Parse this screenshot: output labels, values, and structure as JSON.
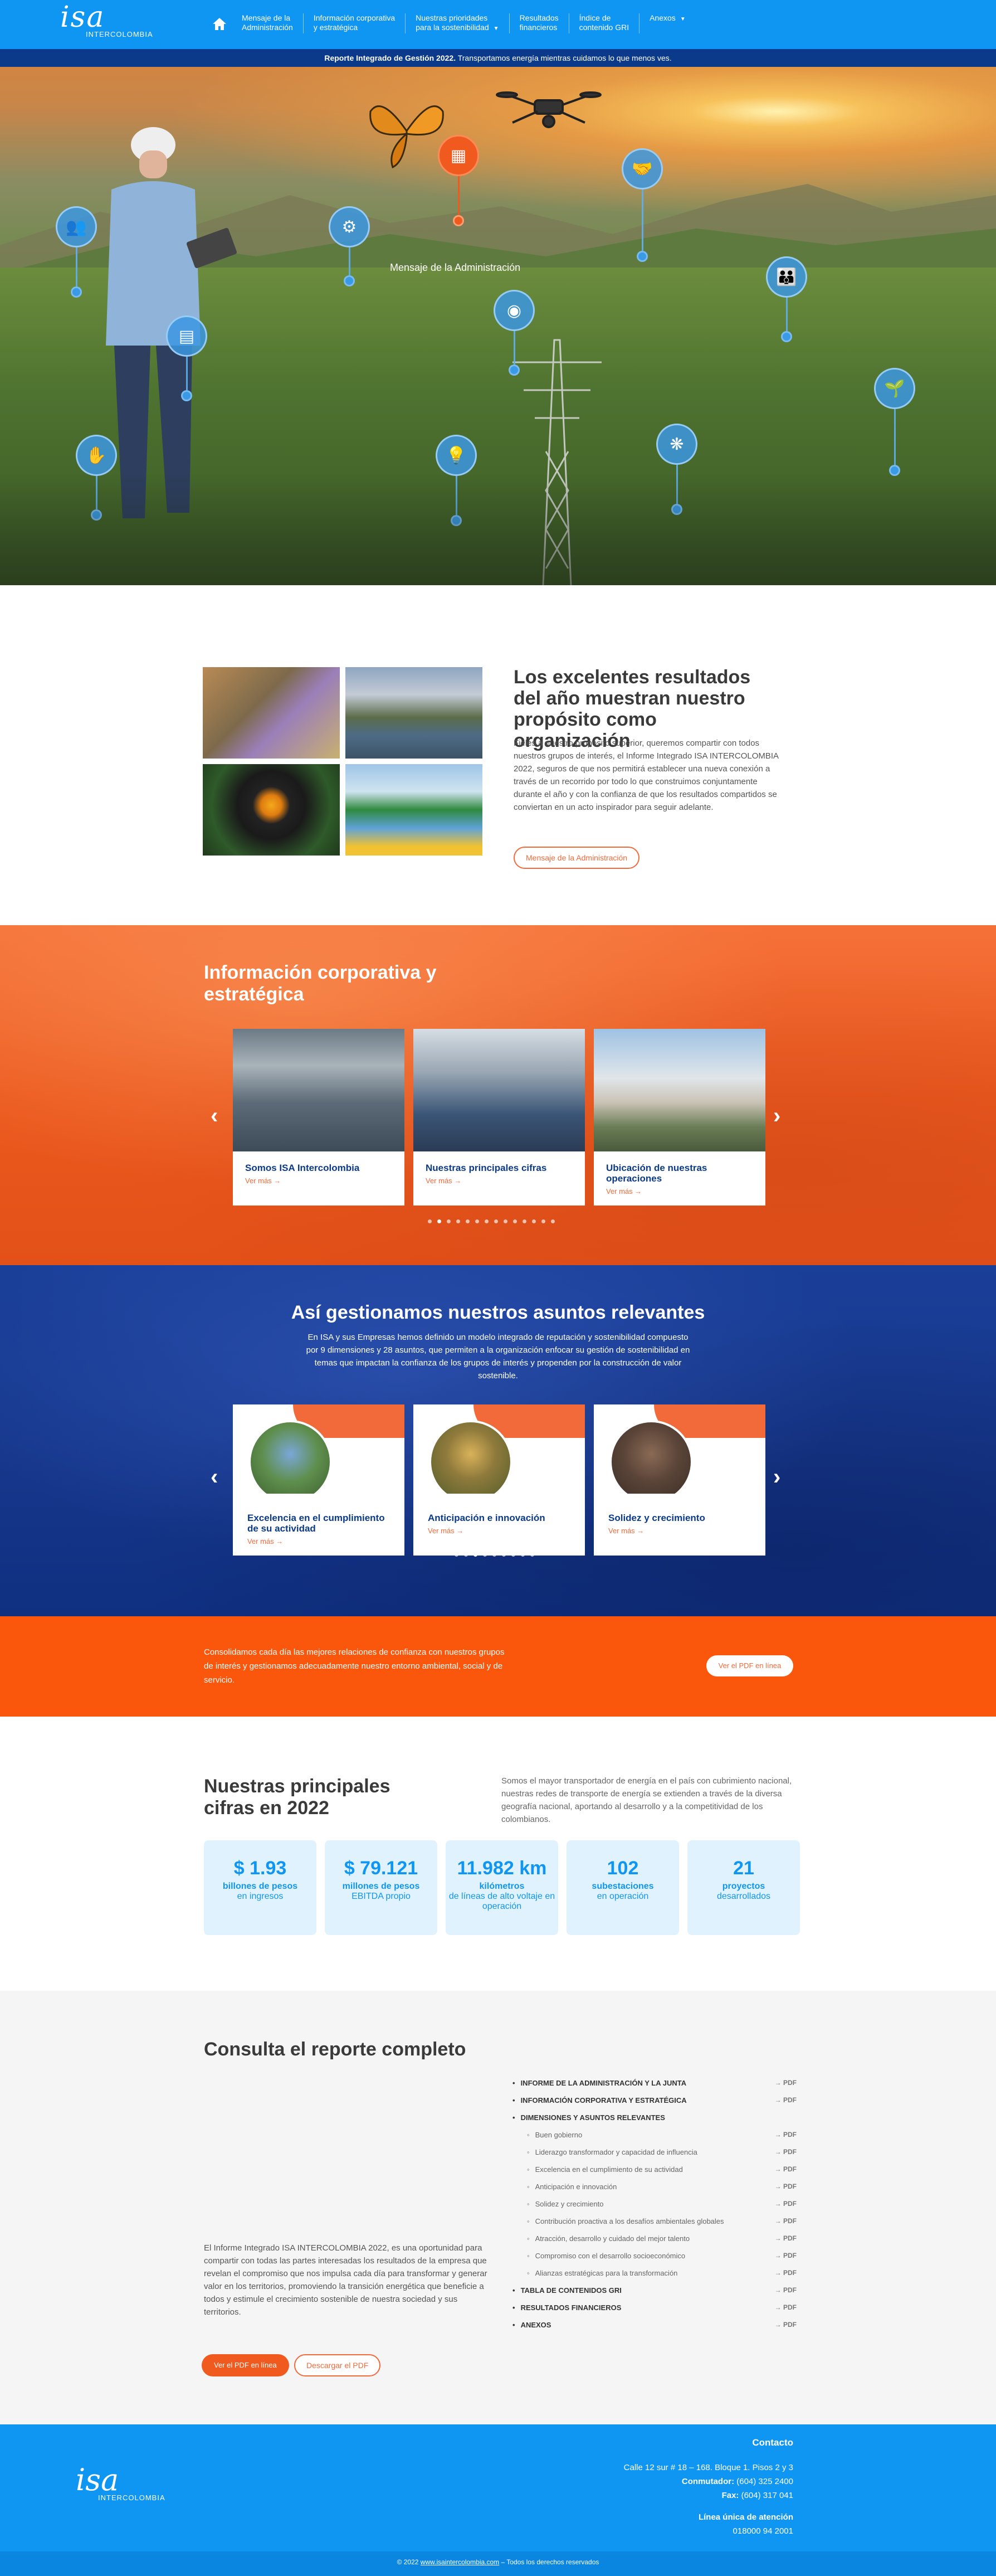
{
  "nav": {
    "logo_word": "isa",
    "logo_sub": "INTERCOLOMBIA",
    "items": [
      {
        "line1": "Mensaje de la",
        "line2": "Administración"
      },
      {
        "line1": "Información corporativa",
        "line2": "y estratégica"
      },
      {
        "line1": "Nuestras prioridades",
        "line2": "para la sostenibilidad"
      },
      {
        "line1": "Resultados",
        "line2": "financieros"
      },
      {
        "line1": "Índice de",
        "line2": "contenido GRI"
      },
      {
        "line1": "Anexos",
        "line2": ""
      }
    ]
  },
  "ribbon": {
    "bold": "Reporte Integrado de Gestión 2022.",
    "text": " Transportamos energía mientras cuidamos lo que menos ves."
  },
  "hero": {
    "active_label": "Mensaje de la Administración",
    "pins": [
      "people-icon",
      "gear-check-icon",
      "report-icon",
      "handshake-icon",
      "graph-bars-icon",
      "globe-people-icon",
      "growth-hand-icon",
      "family-icon",
      "plant-hand-icon",
      "lightbulb-icon",
      "leaf-gear-icon",
      "briefcase-icon"
    ]
  },
  "intro": {
    "title": "Los excelentes resultados del año muestran nuestro propósito como organización",
    "text": "Fieles a nuestro propósito superior, queremos compartir con todos nuestros grupos de interés, el Informe Integrado ISA INTERCOLOMBIA 2022, seguros de que nos permitirá establecer una nueva conexión a través de un recorrido por todo lo que construimos conjuntamente durante el año y con la confianza de que los resultados compartidos se conviertan en un acto inspirador para seguir adelante.",
    "button": "Mensaje de la Administración"
  },
  "corp": {
    "title": "Información corporativa y estratégica",
    "cards": [
      {
        "title": "Somos ISA Intercolombia",
        "link": "Ver más →"
      },
      {
        "title": "Nuestras principales cifras",
        "link": "Ver más →"
      },
      {
        "title": "Ubicación de nuestras operaciones",
        "link": "Ver más →"
      }
    ],
    "dots_count": 14,
    "active_dot": 1
  },
  "gest": {
    "title": "Así gestionamos nuestros asuntos relevantes",
    "lead": "En ISA y sus Empresas hemos definido un modelo integrado de reputación y sostenibilidad compuesto por 9 dimensiones y 28 asuntos, que permiten a la organización enfocar su gestión de sostenibilidad en temas que impactan la confianza de los grupos de interés y propenden por la construcción de valor sostenible.",
    "cards": [
      {
        "title": "Excelencia en el cumplimiento de su actividad",
        "link": "Ver más →"
      },
      {
        "title": "Anticipación e innovación",
        "link": "Ver más →"
      },
      {
        "title": "Solidez y crecimiento",
        "link": "Ver más →"
      }
    ],
    "dots_count": 9,
    "active_dot": 2
  },
  "band": {
    "text": "Consolidamos cada día las mejores relaciones de confianza con nuestros grupos de interés y gestionamos adecuadamente nuestro entorno ambiental, social y de servicio.",
    "button": "Ver el PDF en línea"
  },
  "cifras": {
    "title": "Nuestras principales cifras en 2022",
    "text": "Somos el mayor transportador de energía en el país con cubrimiento nacional, nuestras redes de transporte de energía se extienden a través de la diversa geografía nacional, aportando al desarrollo y a la competitividad de los colombianos.",
    "stats": [
      {
        "value": "$ 1.93",
        "l1": "billones de pesos",
        "l2": "en ingresos"
      },
      {
        "value": "$ 79.121",
        "l1": "millones de pesos",
        "l2": "EBITDA propio"
      },
      {
        "value": "11.982 km",
        "l1": "kilómetros",
        "l2": "de líneas de alto voltaje en operación"
      },
      {
        "value": "102",
        "l1": "subestaciones",
        "l2": "en operación"
      },
      {
        "value": "21",
        "l1": "proyectos",
        "l2": "desarrollados"
      }
    ]
  },
  "report": {
    "title": "Consulta el reporte completo",
    "desc": "El Informe Integrado ISA INTERCOLOMBIA 2022, es una oportunidad para compartir con todas las partes interesadas los resultados de la empresa que revelan el compromiso que nos impulsa cada día para transformar y generar valor en los territorios, promoviendo la transición energética que beneficie a todos y estimule el crecimiento sostenible de nuestra sociedad y sus territorios.",
    "btn_online": "Ver el PDF en línea",
    "btn_download": "Descargar el PDF",
    "pdf_label": "→ PDF",
    "toc": [
      {
        "t": "INFORME DE LA ADMINISTRACIÓN Y LA JUNTA",
        "level": "main"
      },
      {
        "t": "INFORMACIÓN CORPORATIVA Y ESTRATÉGICA",
        "level": "main"
      },
      {
        "t": "DIMENSIONES Y ASUNTOS RELEVANTES",
        "level": "main",
        "nopdf": true
      },
      {
        "t": "Buen gobierno",
        "level": "sub"
      },
      {
        "t": "Liderazgo transformador y capacidad de influencia",
        "level": "sub"
      },
      {
        "t": "Excelencia en el cumplimiento de su actividad",
        "level": "sub"
      },
      {
        "t": "Anticipación e innovación",
        "level": "sub"
      },
      {
        "t": "Solidez y crecimiento",
        "level": "sub"
      },
      {
        "t": "Contribución proactiva a los desafíos ambientales globales",
        "level": "sub"
      },
      {
        "t": "Atracción, desarrollo y cuidado del mejor talento",
        "level": "sub"
      },
      {
        "t": "Compromiso con el desarrollo socioeconómico",
        "level": "sub"
      },
      {
        "t": "Alianzas estratégicas para la transformación",
        "level": "sub"
      },
      {
        "t": "TABLA DE CONTENIDOS GRI",
        "level": "main"
      },
      {
        "t": "RESULTADOS FINANCIEROS",
        "level": "main"
      },
      {
        "t": "ANEXOS",
        "level": "main"
      }
    ]
  },
  "footer": {
    "logo_word": "isa",
    "logo_sub": "INTERCOLOMBIA",
    "heading": "Contacto",
    "address": "Calle 12 sur # 18 – 168. Bloque 1. Pisos 2 y 3",
    "conmutador_label": "Conmutador:",
    "conmutador": " (604) 325 2400",
    "fax_label": "Fax:",
    "fax": " (604) 317 041",
    "linea_label": "Línea única de atención",
    "linea": "018000 94 2001",
    "copy_pre": "© 2022 ",
    "copy_link": "www.isaintercolombia.com",
    "copy_post": " – Todos los derechos reservados"
  }
}
